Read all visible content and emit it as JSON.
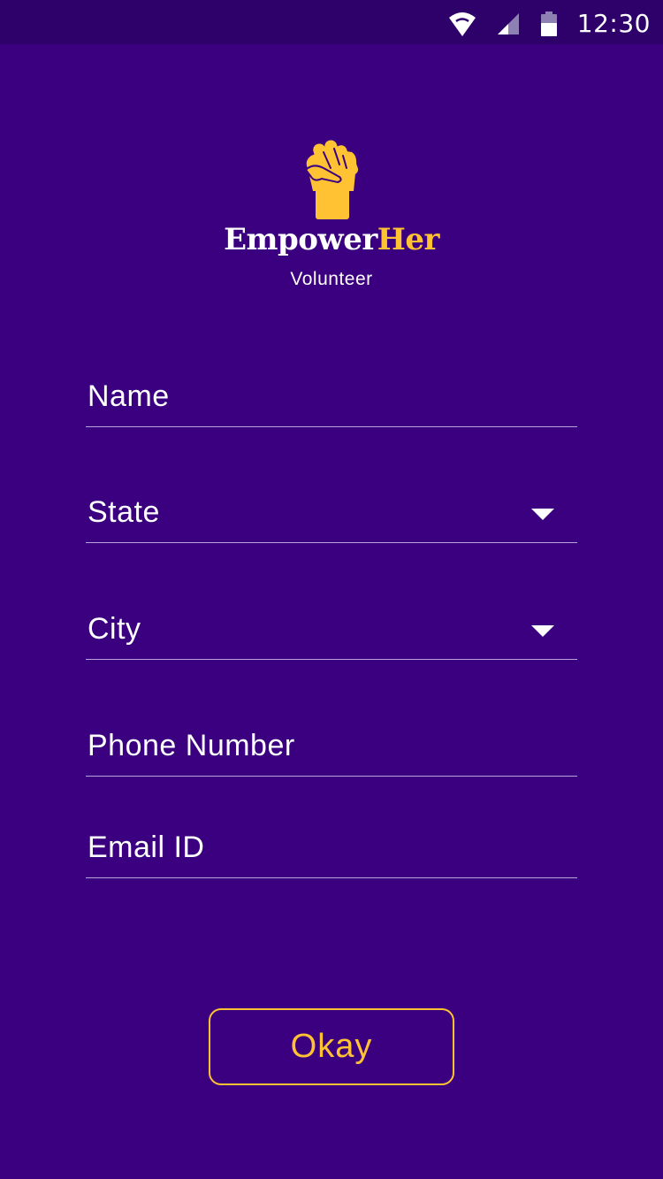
{
  "status_bar": {
    "time": "12:30",
    "icons": [
      "wifi-icon",
      "cell-signal-icon",
      "battery-icon"
    ]
  },
  "app": {
    "logo_icon": "raised-fist-icon",
    "brand_part1": "Empower",
    "brand_part2": "Her",
    "subtitle": "Volunteer"
  },
  "form": {
    "name_label": "Name",
    "state_label": "State",
    "city_label": "City",
    "phone_label": "Phone Number",
    "email_label": "Email ID"
  },
  "button": {
    "okay_label": "Okay"
  },
  "colors": {
    "background": "#3a0080",
    "status_bar": "#2d006a",
    "accent": "#ffc233",
    "text": "#ffffff",
    "underline": "#b9a3de"
  }
}
